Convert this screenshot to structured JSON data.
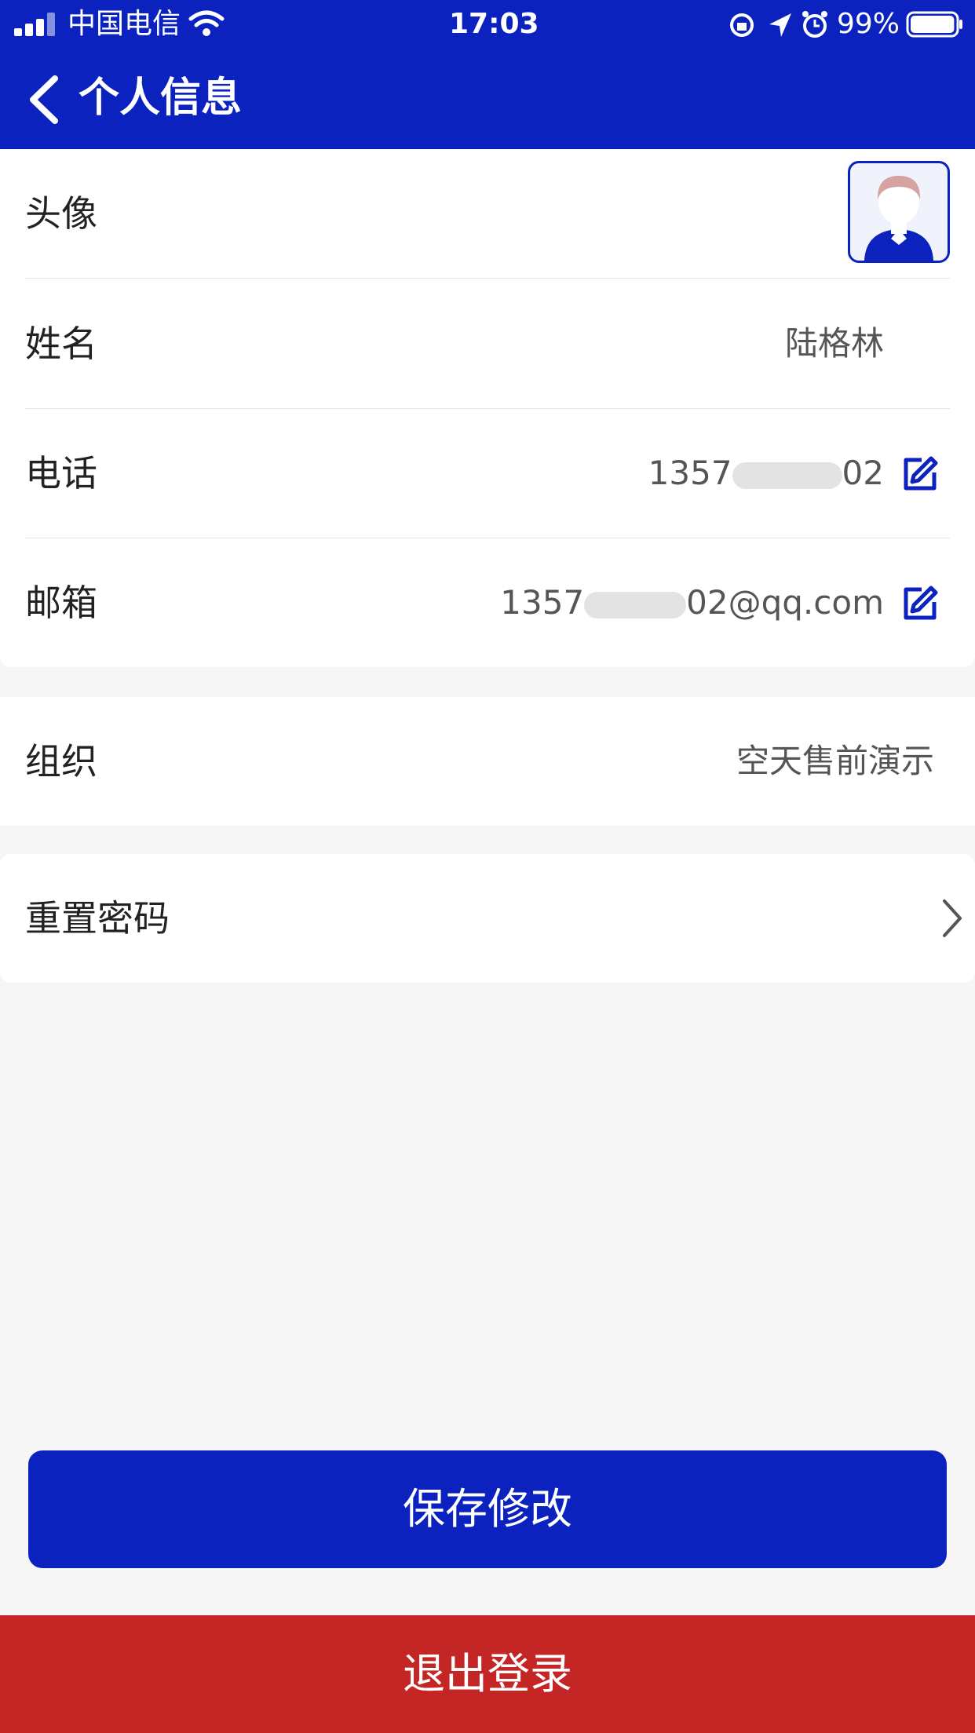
{
  "status_bar": {
    "carrier": "中国电信",
    "time": "17:03",
    "battery": "99%",
    "battery_level": 0.99,
    "icons": [
      "signal-icon",
      "wifi-icon",
      "orientation-lock-icon",
      "location-icon",
      "alarm-icon",
      "battery-icon"
    ]
  },
  "nav": {
    "back_icon": "chevron-left-icon",
    "title": "个人信息"
  },
  "profile": {
    "avatar_label": "头像",
    "name_label": "姓名",
    "name_value": "陆格林",
    "phone_label": "电话",
    "phone_prefix": "1357",
    "phone_suffix": "02",
    "email_label": "邮箱",
    "email_prefix": "1357",
    "email_suffix": "02@qq.com",
    "edit_icon": "edit-icon"
  },
  "org": {
    "label": "组织",
    "value": "空天售前演示"
  },
  "reset": {
    "label": "重置密码",
    "icon": "chevron-right-icon"
  },
  "buttons": {
    "save": "保存修改",
    "logout": "退出登录"
  },
  "colors": {
    "primary": "#0b22bf",
    "danger": "#c42626",
    "background": "#f6f6f6"
  }
}
